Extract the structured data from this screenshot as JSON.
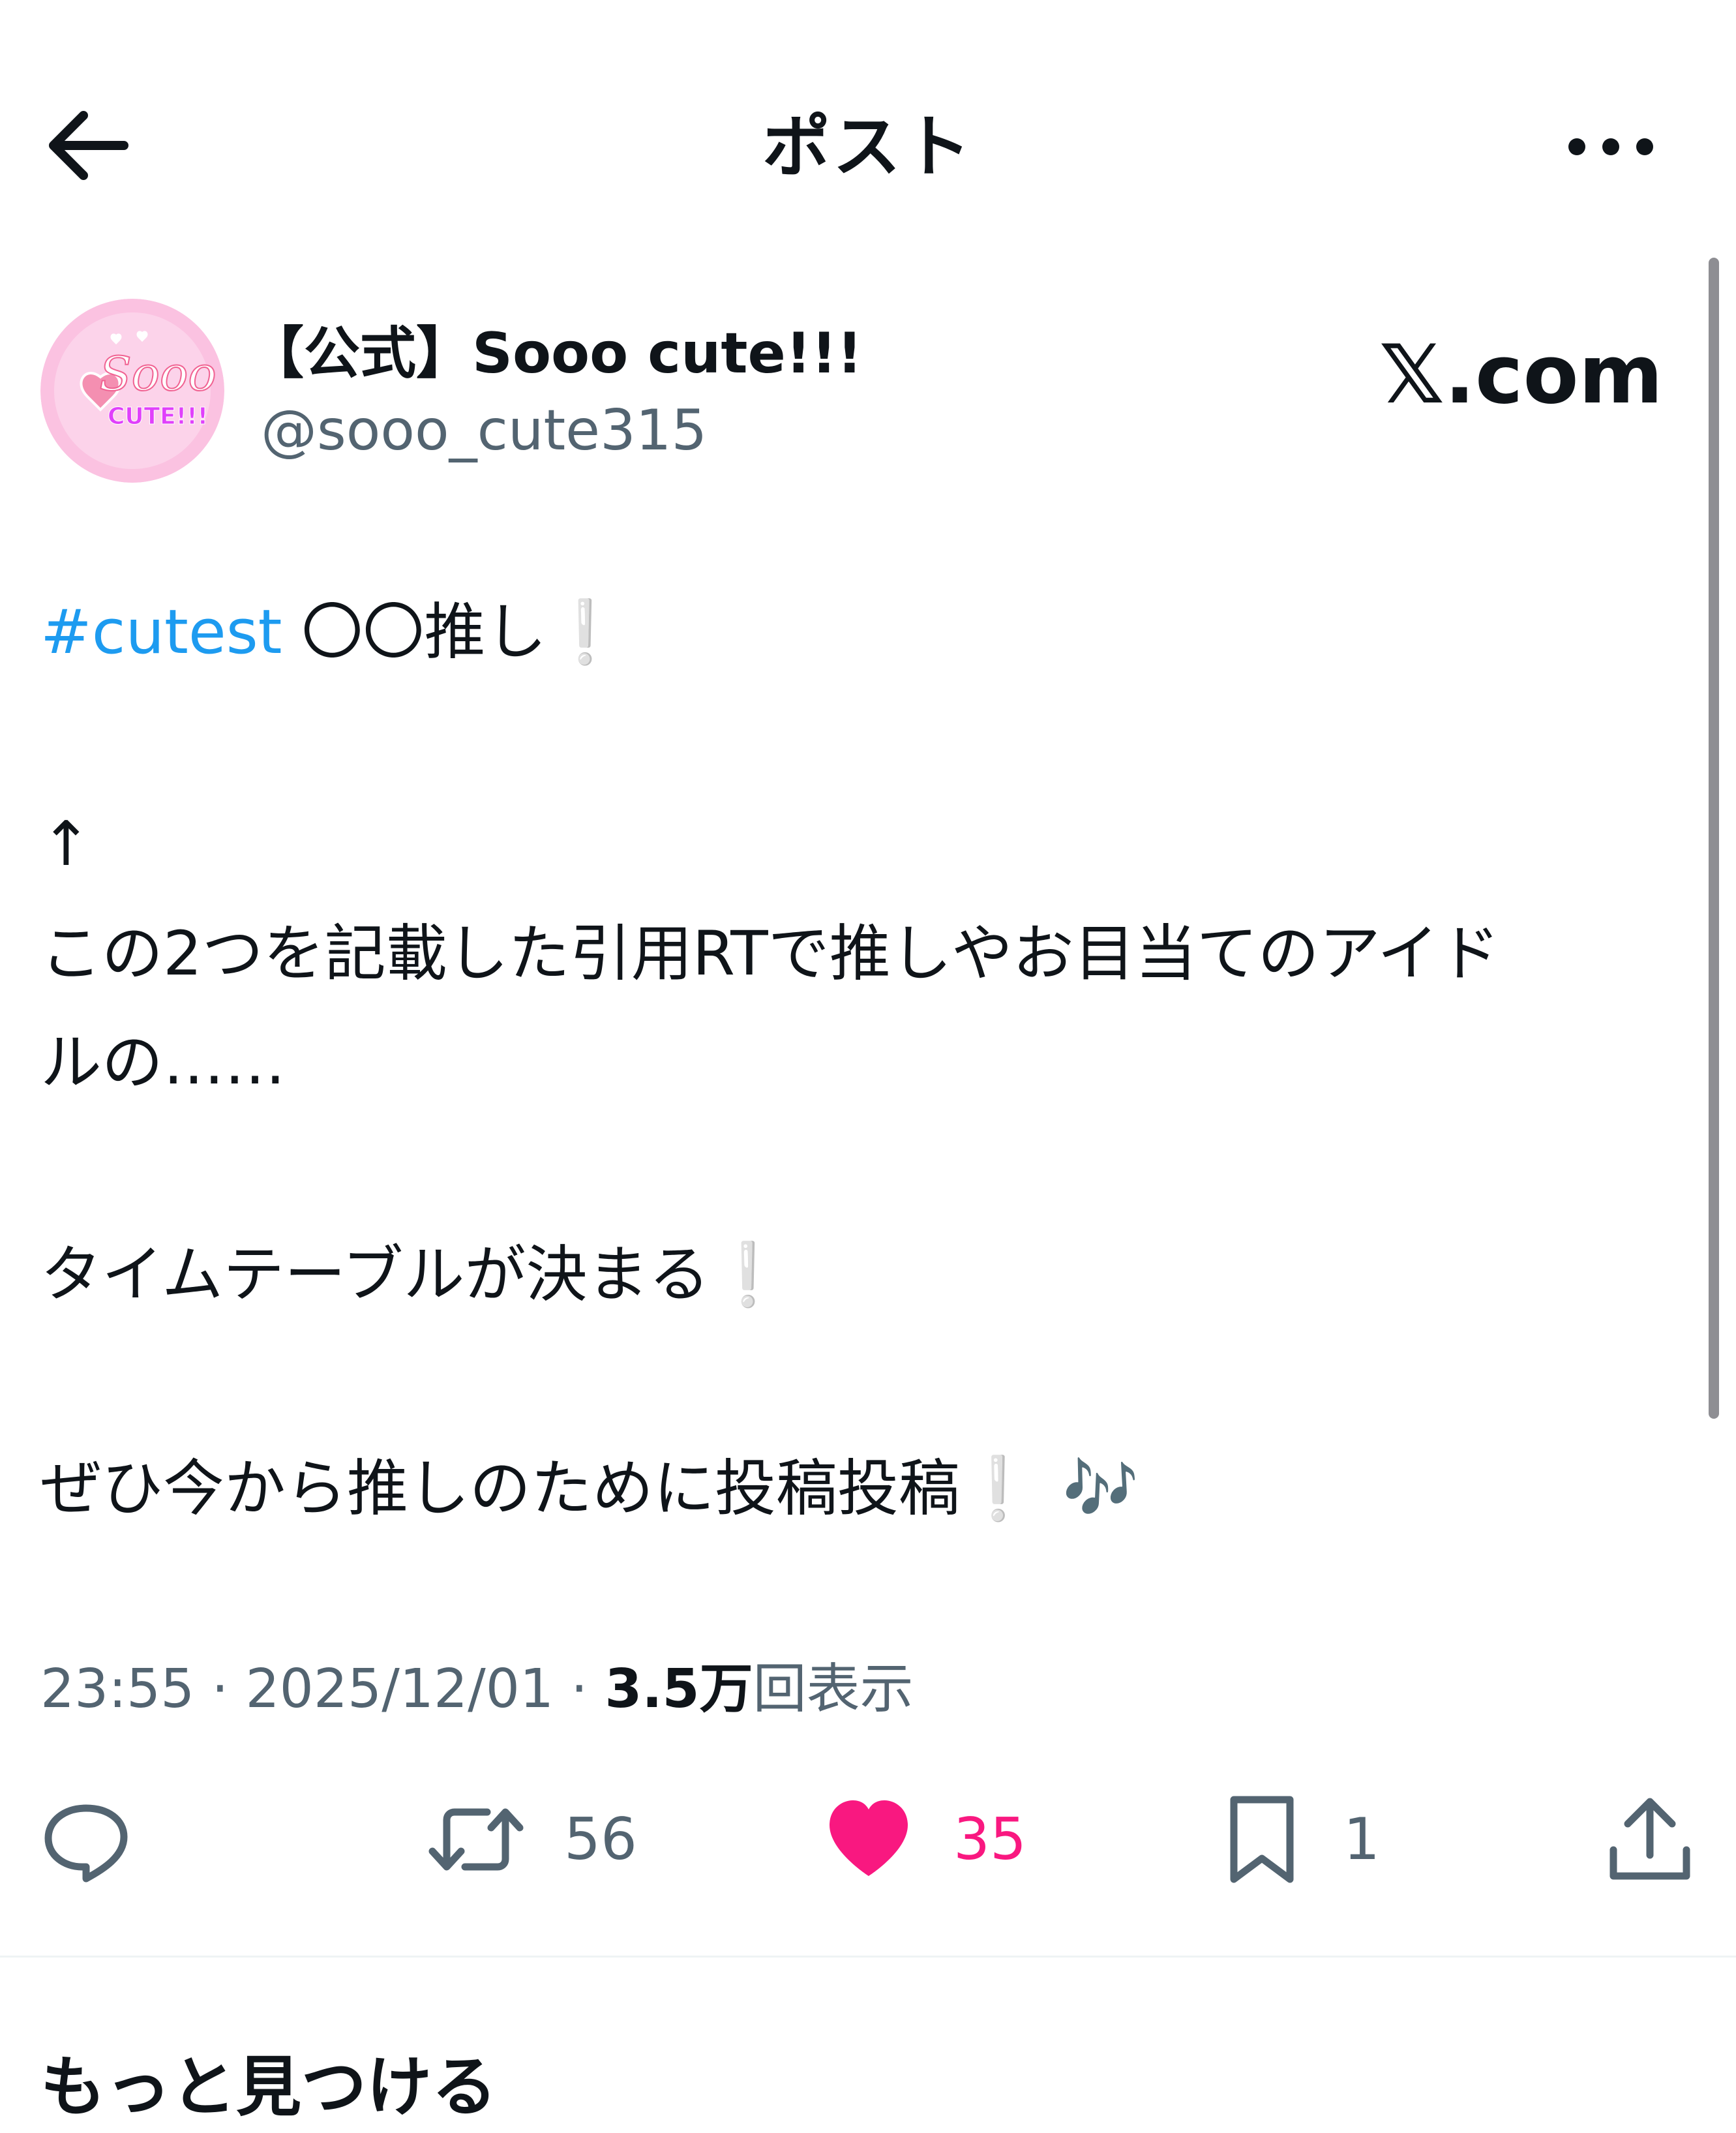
{
  "header": {
    "title": "ポスト"
  },
  "author": {
    "display_name": "【公式】Sooo cute!!!",
    "handle": "@sooo_cute315",
    "avatar_text_top": "Sooo",
    "avatar_text_bottom": "CUTE!!!"
  },
  "watermark": "𝕏.com",
  "post": {
    "line1": {
      "hashtag": "#cutest",
      "text": " 〇〇推し",
      "excl": "❕"
    },
    "line2": "↑",
    "line3": "この2つを記載した引用RTで推しやお目当てのアイド",
    "line4": "ルの……",
    "line5": {
      "text": "タイムテーブルが決まる",
      "excl": "❕"
    },
    "line6": {
      "text": "ぜひ今から推しのために投稿投稿",
      "excl": "❕",
      "emoji": "🎶"
    }
  },
  "meta": {
    "time": "23:55",
    "sep1": " · ",
    "date": "2025/12/01",
    "sep2": " · ",
    "views_count": "3.5万",
    "views_label": "回表示"
  },
  "actions": {
    "reply_count": "",
    "retweet_count": "56",
    "like_count": "35",
    "bookmark_count": "1"
  },
  "more_section": {
    "heading": "もっと見つける"
  },
  "colors": {
    "accent": "#1d9bf0",
    "like": "#f91880",
    "secondary_text": "#536471",
    "avatar_bg": "#fbc2e1"
  },
  "icons": {
    "back": "arrow-left-icon",
    "more": "more-dots-icon",
    "reply": "reply-icon",
    "retweet": "retweet-icon",
    "like": "heart-filled-icon",
    "bookmark": "bookmark-icon",
    "share": "share-icon"
  }
}
